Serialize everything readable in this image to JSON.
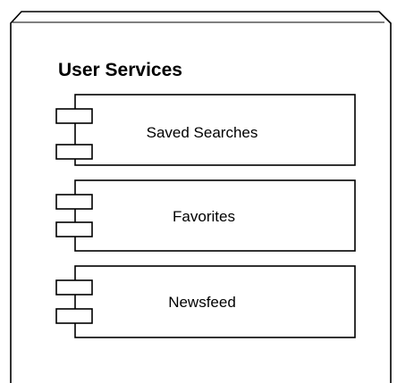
{
  "package": {
    "title": "User Services"
  },
  "components": [
    {
      "label": "Saved Searches"
    },
    {
      "label": "Favorites"
    },
    {
      "label": "Newsfeed"
    }
  ]
}
